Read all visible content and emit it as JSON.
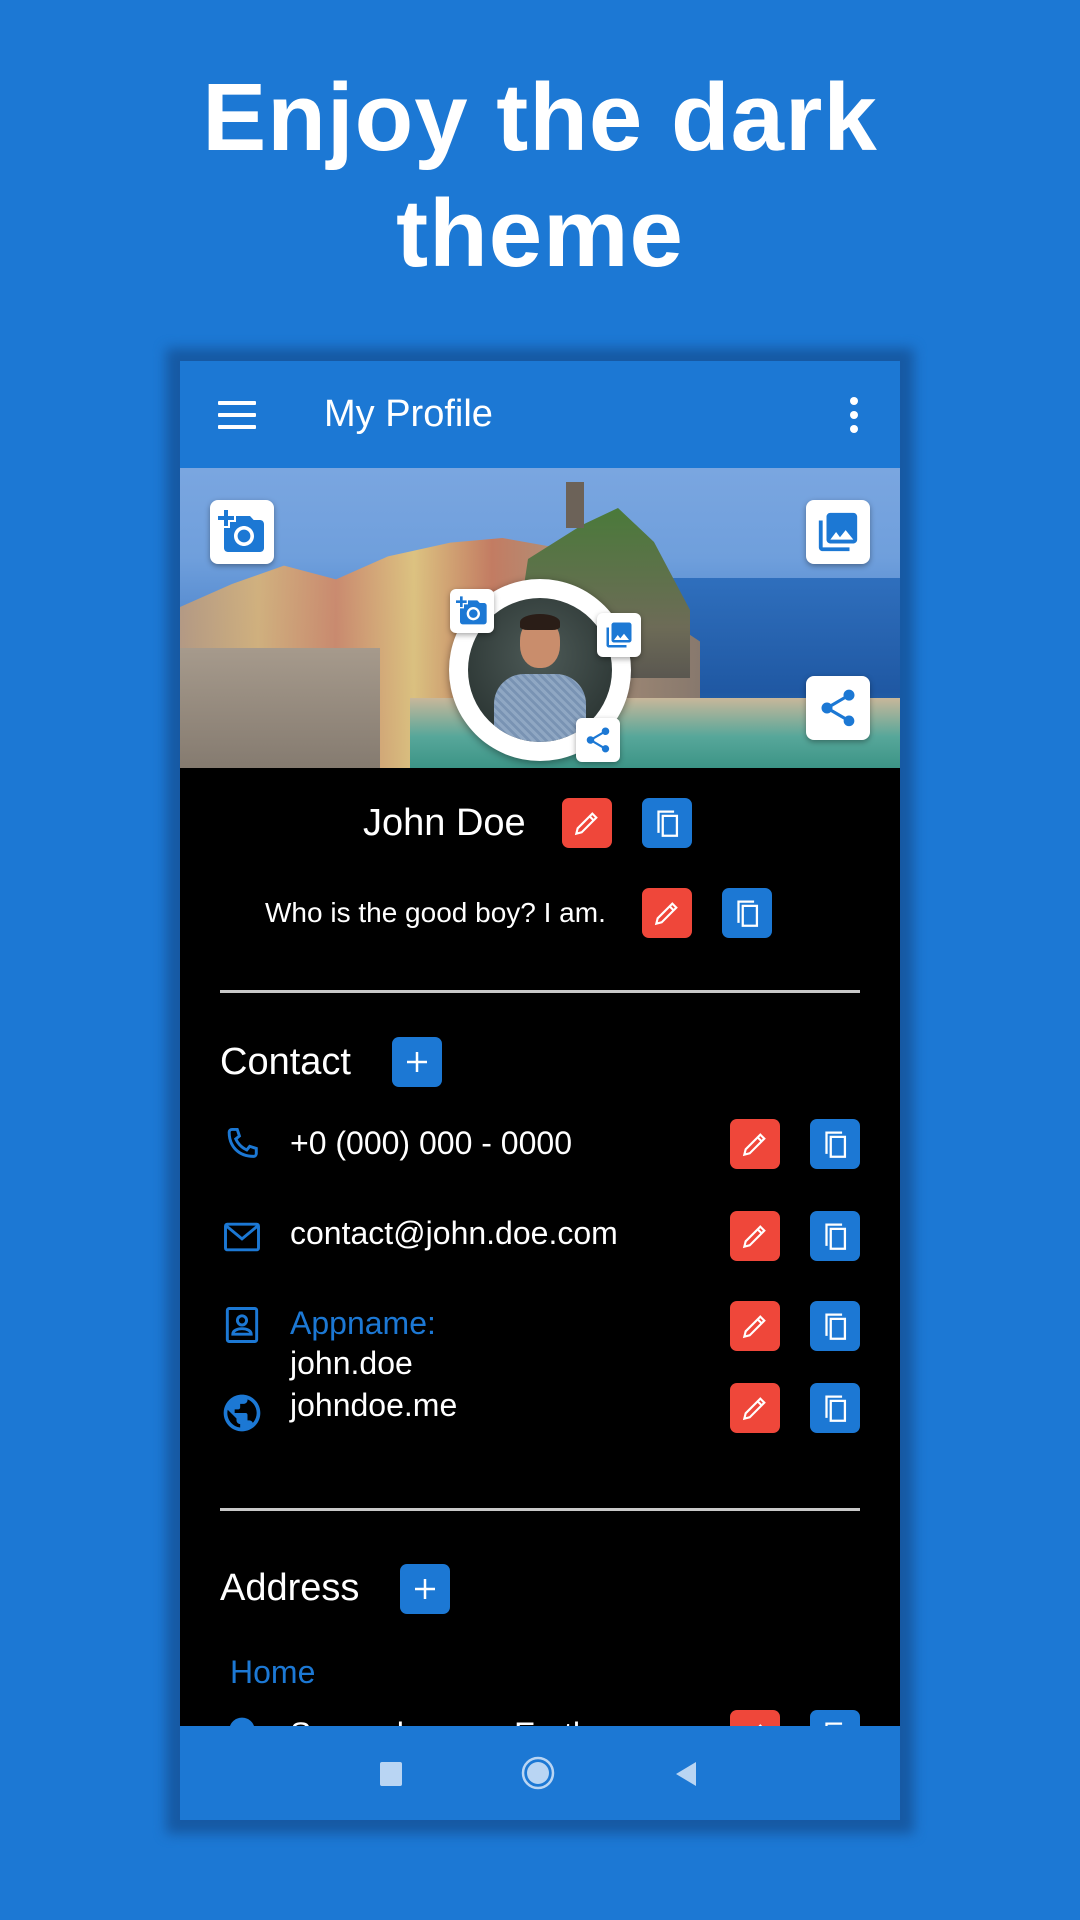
{
  "promo": {
    "headline_line1": "Enjoy the dark",
    "headline_line2": "theme"
  },
  "colors": {
    "background": "#1c78d4",
    "primary": "#1c78d4",
    "edit_red": "#ef473a",
    "content_bg": "#000000",
    "text": "#ffffff",
    "divider": "#c8c8c8"
  },
  "appbar": {
    "menu_icon": "hamburger-menu-icon",
    "title": "My Profile",
    "more_icon": "more-vert-icon"
  },
  "banner": {
    "cover_image": "coastal-village-photo",
    "cover_camera_icon": "add-a-photo-icon",
    "cover_gallery_icon": "photo-library-icon",
    "cover_share_icon": "share-icon",
    "avatar_image": "profile-photo-man",
    "avatar_camera_icon": "add-a-photo-icon",
    "avatar_gallery_icon": "photo-library-icon",
    "avatar_share_icon": "share-icon"
  },
  "profile": {
    "name": "John Doe",
    "bio": "Who is the good boy? I am.",
    "edit_icon": "pencil-icon",
    "copy_icon": "copy-icon"
  },
  "contact": {
    "title": "Contact",
    "add_icon": "plus-icon",
    "items": [
      {
        "icon": "phone-icon",
        "label": "",
        "value": "+0 (000) 000 - 0000"
      },
      {
        "icon": "email-icon",
        "label": "",
        "value": "contact@john.doe.com"
      },
      {
        "icon": "contact-card-icon",
        "label": "Appname:",
        "value": "john.doe"
      },
      {
        "icon": "globe-icon",
        "label": "",
        "value": "johndoe.me"
      }
    ]
  },
  "address": {
    "title": "Address",
    "add_icon": "plus-icon",
    "groups": [
      {
        "label": "Home",
        "value": "Somewhere on Earth",
        "icon": "location-pin-icon"
      }
    ]
  },
  "navbar": {
    "recents_icon": "recents-square-icon",
    "home_icon": "home-circle-icon",
    "back_icon": "back-triangle-icon"
  }
}
